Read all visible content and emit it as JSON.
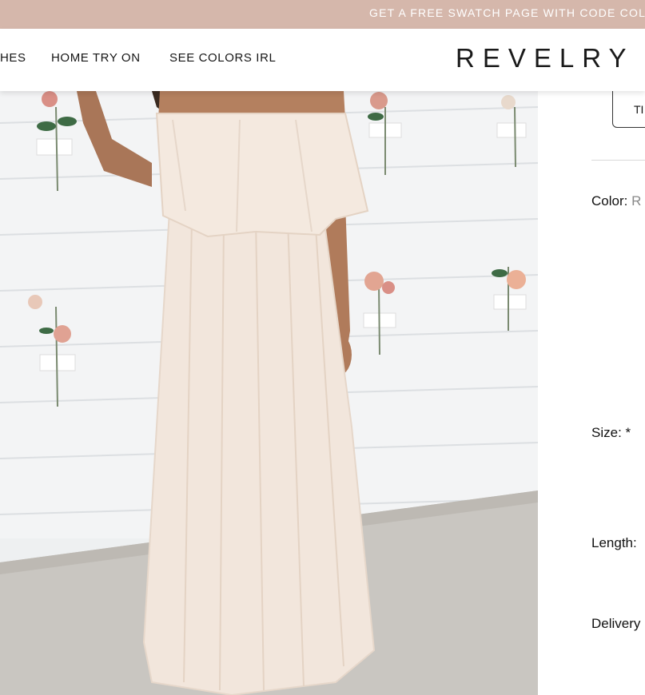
{
  "promo": {
    "text": "GET A FREE SWATCH PAGE WITH CODE COL"
  },
  "nav": {
    "links": [
      "HES",
      "HOME TRY ON",
      "SEE COLORS IRL"
    ],
    "logo": "REVELRY"
  },
  "product_image": {
    "description_icon": "dress-photo"
  },
  "options": {
    "try_button_label": "TI",
    "color_label": "Color:",
    "color_value": "R",
    "size_label": "Size: *",
    "length_label": "Length:",
    "delivery_label": "Delivery"
  },
  "colors": {
    "promo_bg": "#d5b7ab",
    "dress": "#f2e6dc",
    "wall": "#f3f4f5"
  }
}
